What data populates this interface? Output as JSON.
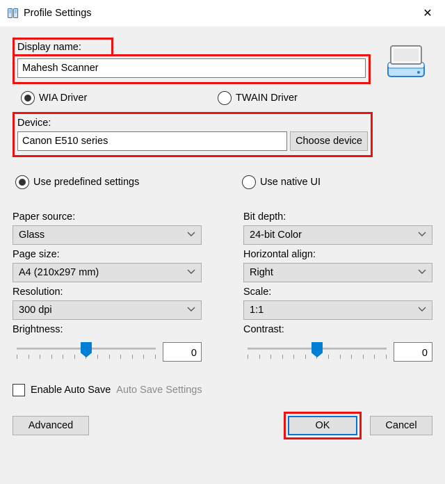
{
  "window": {
    "title": "Profile Settings",
    "close_glyph": "✕"
  },
  "display_name": {
    "label": "Display name:",
    "value": "Mahesh Scanner"
  },
  "driver": {
    "wia_label": "WIA Driver",
    "twain_label": "TWAIN Driver",
    "selected": "wia"
  },
  "device": {
    "label": "Device:",
    "value": "Canon E510 series",
    "choose_label": "Choose device"
  },
  "settings_mode": {
    "predefined_label": "Use predefined settings",
    "native_label": "Use native UI",
    "selected": "predefined"
  },
  "left_col": {
    "paper_source": {
      "label": "Paper source:",
      "value": "Glass"
    },
    "page_size": {
      "label": "Page size:",
      "value": "A4 (210x297 mm)"
    },
    "resolution": {
      "label": "Resolution:",
      "value": "300 dpi"
    },
    "brightness": {
      "label": "Brightness:",
      "value": "0"
    }
  },
  "right_col": {
    "bit_depth": {
      "label": "Bit depth:",
      "value": "24-bit Color"
    },
    "h_align": {
      "label": "Horizontal align:",
      "value": "Right"
    },
    "scale": {
      "label": "Scale:",
      "value": "1:1"
    },
    "contrast": {
      "label": "Contrast:",
      "value": "0"
    }
  },
  "auto_save": {
    "check_label": "Enable Auto Save",
    "link_label": "Auto Save Settings",
    "checked": false
  },
  "buttons": {
    "advanced": "Advanced",
    "ok": "OK",
    "cancel": "Cancel"
  }
}
